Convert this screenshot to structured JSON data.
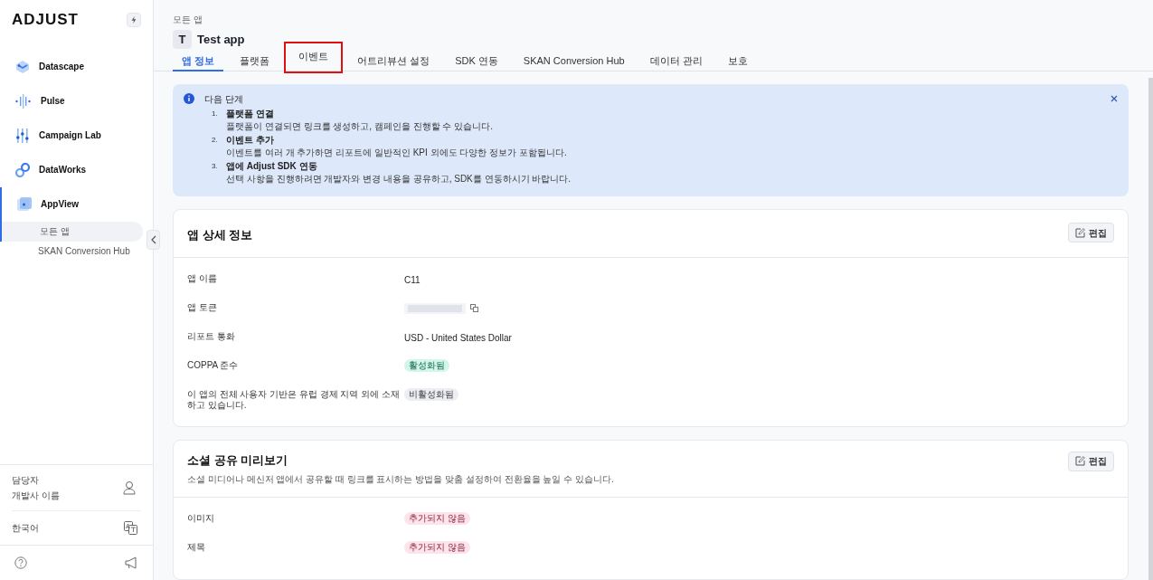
{
  "sidebar": {
    "logo": "ADJUST",
    "items": [
      {
        "label": "Datascape",
        "selected": false,
        "kind": "datascape"
      },
      {
        "label": "Pulse",
        "selected": false,
        "kind": "pulse"
      },
      {
        "label": "Campaign Lab",
        "selected": false,
        "kind": "campaign"
      },
      {
        "label": "DataWorks",
        "selected": false,
        "kind": "dataworks"
      },
      {
        "label": "AppView",
        "selected": true,
        "kind": "appview",
        "children": [
          {
            "label": "모든 앱",
            "selected": true
          },
          {
            "label": "SKAN Conversion Hub",
            "selected": false
          }
        ]
      }
    ],
    "user": {
      "role": "담당자",
      "name": "개발사 이름"
    },
    "language": "한국어"
  },
  "breadcrumb": "모든 앱",
  "app": {
    "initial": "T",
    "title": "Test app"
  },
  "tabs": [
    {
      "label": "앱 정보",
      "selected": true,
      "highlighted": false
    },
    {
      "label": "플랫폼",
      "selected": false,
      "highlighted": false
    },
    {
      "label": "이벤트",
      "selected": false,
      "highlighted": true
    },
    {
      "label": "어트리뷰션 설정",
      "selected": false,
      "highlighted": false
    },
    {
      "label": "SDK 연동",
      "selected": false,
      "highlighted": false
    },
    {
      "label": "SKAN Conversion Hub",
      "selected": false,
      "highlighted": false
    },
    {
      "label": "데이터 관리",
      "selected": false,
      "highlighted": false
    },
    {
      "label": "보호",
      "selected": false,
      "highlighted": false
    }
  ],
  "notice": {
    "title": "다음 단계",
    "steps": [
      {
        "number": "1.",
        "title": "플랫폼 연결",
        "text": "플랫폼이 연결되면 링크를 생성하고, 캠페인을 진행할 수 있습니다."
      },
      {
        "number": "2.",
        "title": "이벤트 추가",
        "text": "이벤트를 여러 개 추가하면 리포트에 일반적인 KPI 외에도 다양한 정보가 포함됩니다."
      },
      {
        "number": "3.",
        "title": "앱에 Adjust SDK 연동",
        "text": "선택 사항을 진행하려면 개발자와 변경 내용을 공유하고, SDK를 연동하시기 바랍니다."
      }
    ]
  },
  "cards": [
    {
      "title": "앱 상세 정보",
      "edit_label": "편집",
      "rows": [
        {
          "label": "앱 이름",
          "kind": "text",
          "value": "C11"
        },
        {
          "label": "앱 토큰",
          "kind": "hidden"
        },
        {
          "label": "리포트 통화",
          "kind": "text",
          "value": "USD - United States Dollar"
        },
        {
          "label": "COPPA 준수",
          "kind": "badge",
          "badge": {
            "kind": "enabled",
            "text": "활성화됨"
          }
        },
        {
          "label": "이 앱의 전체 사용자 기반은 유럽 경제 지역 외에 소재하고 있습니다.",
          "kind": "badge",
          "badge": {
            "kind": "disabled",
            "text": "비활성화됨"
          }
        }
      ]
    },
    {
      "title": "소셜 공유 미리보기",
      "description": "소셜 미디어나 메신저 앱에서 공유할 때 링크를 표시하는 방법을 맞춤 설정하여 전환율을 높일 수 있습니다.",
      "edit_label": "편집",
      "rows": [
        {
          "label": "이미지",
          "kind": "badge",
          "badge": {
            "kind": "not_added",
            "text": "추가되지 않음"
          }
        },
        {
          "label": "제목",
          "kind": "badge",
          "badge": {
            "kind": "not_added",
            "text": "추가되지 않음"
          }
        }
      ]
    }
  ]
}
